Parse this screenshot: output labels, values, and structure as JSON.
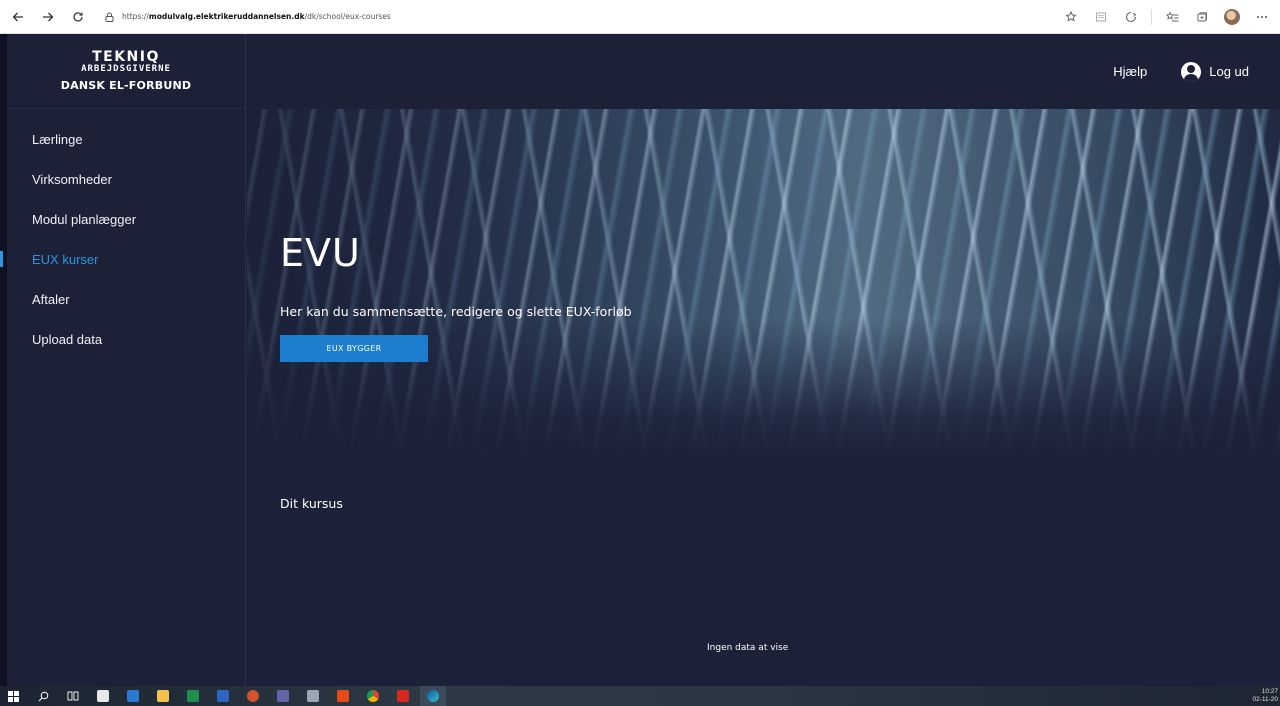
{
  "browser": {
    "url_prefix": "https://",
    "url_domain": "modulvalg.elektrikeruddannelsen.dk",
    "url_path": "/dk/school/eux-courses"
  },
  "brand": {
    "line1": "TEKNIQ",
    "line2": "ARBEJDSGIVERNE",
    "line3": "DANSK EL-FORBUND"
  },
  "sidebar": {
    "items": [
      {
        "label": "Lærlinge"
      },
      {
        "label": "Virksomheder"
      },
      {
        "label": "Modul planlægger"
      },
      {
        "label": "EUX kurser"
      },
      {
        "label": "Aftaler"
      },
      {
        "label": "Upload data"
      }
    ],
    "active_index": 3
  },
  "header": {
    "help_label": "Hjælp",
    "logout_label": "Log ud"
  },
  "hero": {
    "title": "EVU",
    "subtitle": "Her kan du sammensætte, redigere og slette EUX-forløb",
    "button_label": "EUX BYGGER"
  },
  "main": {
    "section_title": "Dit kursus",
    "empty_text": "Ingen data at vise"
  },
  "taskbar": {
    "time": "10:27",
    "date": "02-11-20"
  },
  "colors": {
    "background": "#1b2139",
    "accent": "#2a97de",
    "button": "#1d7dce"
  }
}
